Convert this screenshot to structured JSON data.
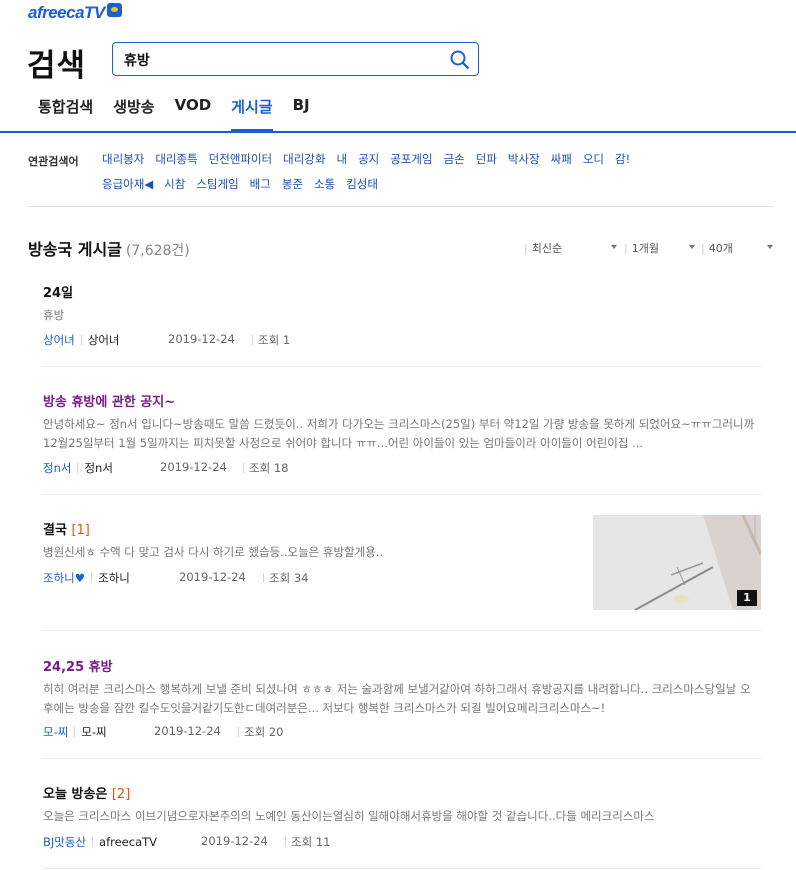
{
  "header": {
    "logo_text": "afreecaTV",
    "search_title": "검색",
    "search_value": "휴방"
  },
  "tabs": [
    {
      "label": "통합검색",
      "active": false
    },
    {
      "label": "생방송",
      "active": false
    },
    {
      "label": "VOD",
      "active": false
    },
    {
      "label": "게시글",
      "active": true
    },
    {
      "label": "BJ",
      "active": false
    }
  ],
  "related": {
    "label": "연관검색어",
    "words": [
      "대리봉자",
      "대리종특",
      "던전앤파이터",
      "대리강화",
      "내",
      "공지",
      "공포게임",
      "금손",
      "던파",
      "박사장",
      "싸패",
      "오디",
      "감!",
      "응급아재◀",
      "시참",
      "스팀게임",
      "배그",
      "봉준",
      "소통",
      "킴성태"
    ]
  },
  "board": {
    "title": "방송국 게시글",
    "count": "(7,628건)",
    "filters": {
      "sort": "최신순",
      "period": "1개월",
      "per_page": "40개"
    }
  },
  "posts": [
    {
      "title": "24일",
      "comment_count": "",
      "body": "휴방",
      "nick": "상어녀",
      "id": "상어녀",
      "date": "2019-12-24",
      "views": "조회 1",
      "visited": false
    },
    {
      "title": "방송 휴방에 관한 공지~",
      "comment_count": "",
      "body": "안녕하세요~ 정n서 입니다~방송때도 말씀 드렸듯이.. 저희가 다가오는 크리스마스(25일) 부터 약12일 가량 방송을 못하게 되었어요~ㅠㅠ그러니까 12월25일부터 1월 5일까지는 피치못할 사정으로 쉬어야 합니다 ㅠㅠ...어린 아이들이 있는 엄마들이라 아이들이 어린이집 ...",
      "nick": "정n서",
      "id": "정n서",
      "date": "2019-12-24",
      "views": "조회 18",
      "visited": true
    },
    {
      "title": "결국",
      "comment_count": "[1]",
      "body": "병원신세ㅎ 수액 다 맞고 검사 다시 하기로 했습등..오늘은 휴방할게용..",
      "nick": "조하니♥",
      "id": "조하니",
      "date": "2019-12-24",
      "views": "조회 34",
      "visited": false,
      "thumb_badge": "1"
    },
    {
      "title": "24,25 휴방",
      "comment_count": "",
      "body": "히히 여러분 크리스마스 행복하게 보낼 준비 되셨나여 ㅎㅎㅎ 저는 술과함께 보낼거같아여 하하그래서 휴방공지를 내려합니다.. 크리스마스당일날 오후에는 방송을 잠깐 킬수도잇을거같기도한ㄷ데여러분은... 저보다 행복한 크리스마스가 되길 빌어요메리크리스마스~!",
      "nick": "모-찌",
      "id": "모-찌",
      "date": "2019-12-24",
      "views": "조회 20",
      "visited": true
    },
    {
      "title": "오늘 방송은",
      "comment_count": "[2]",
      "body": "오늘은 크리스마스 이브기념으로자본주의의 노예인 동산이는열심히 일해야해서휴방을 해야할 것 같습니다..다들 메리크리스마스",
      "nick": "BJ맛동산",
      "id": "afreecaTV",
      "date": "2019-12-24",
      "views": "조회 11",
      "visited": false
    }
  ],
  "colors": {
    "accent": "#1a5fd6",
    "visited_title": "#7a1a8a",
    "comment_count": "#e8550b"
  }
}
